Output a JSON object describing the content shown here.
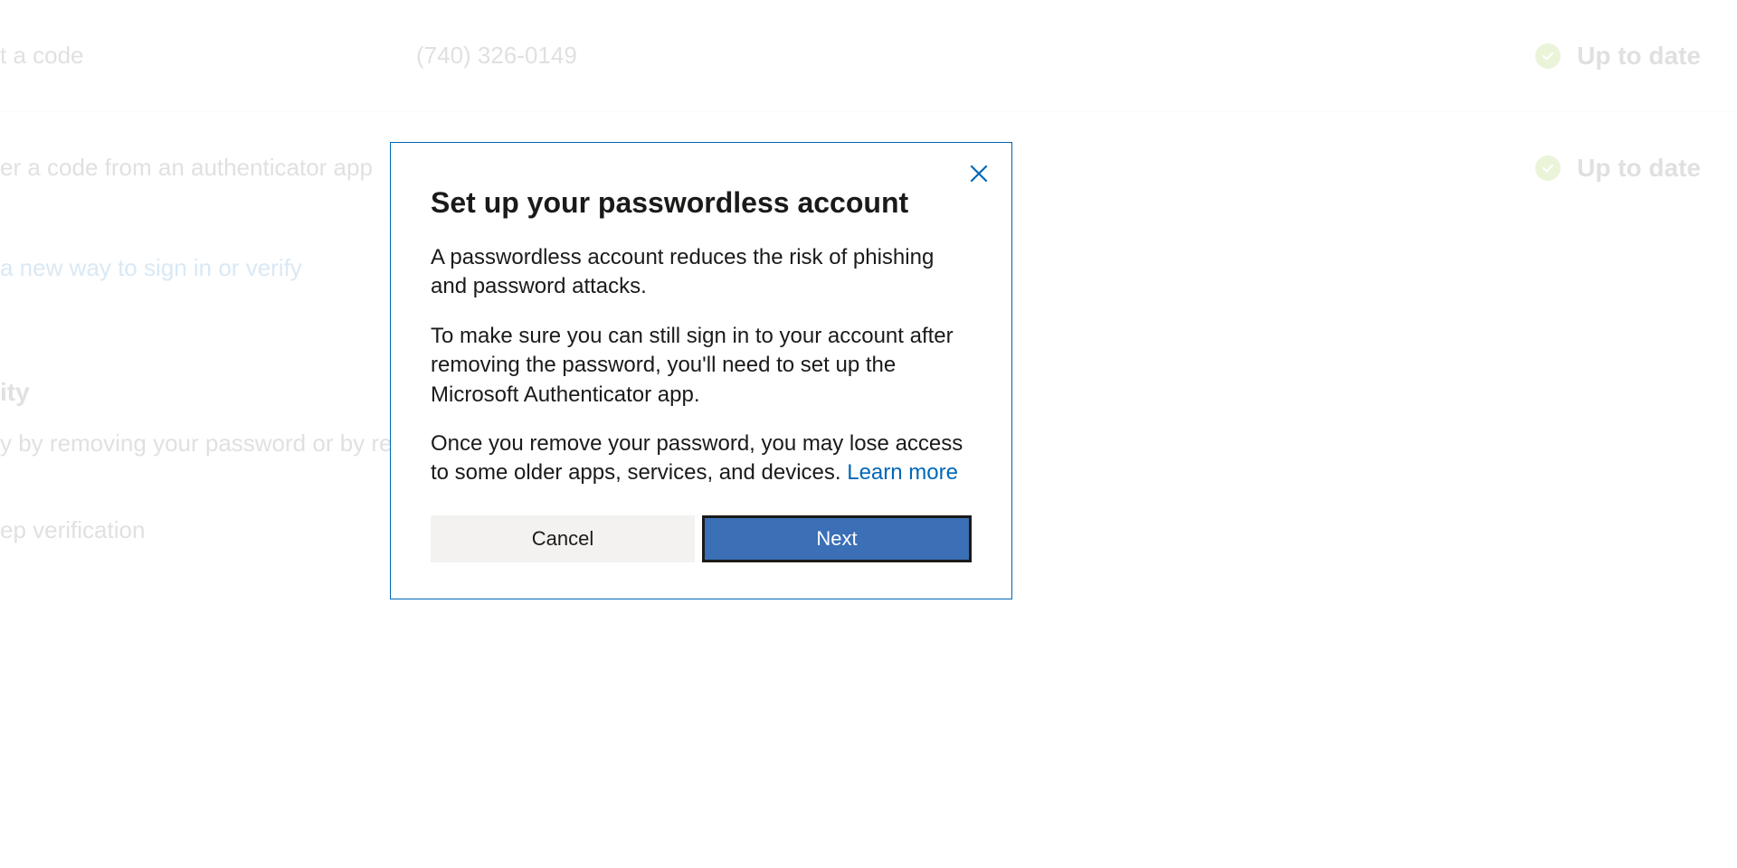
{
  "background": {
    "rows": [
      {
        "label": "t a code",
        "value": "(740) 326-0149",
        "status": "Up to date"
      },
      {
        "label": "er a code from an authenticator app",
        "value": "",
        "status": "Up to date"
      }
    ],
    "add_link": "a new way to sign in or verify",
    "section_title": "ity",
    "section_desc": "y by removing your password or by requ                                                                                                                     ore if it is right for you.",
    "subitem": "ep verification"
  },
  "modal": {
    "title": "Set up your passwordless account",
    "p1": "A passwordless account reduces the risk of phishing and password attacks.",
    "p2": "To make sure you can still sign in to your account after removing the password, you'll need to set up the Microsoft Authenticator app.",
    "p3_a": "Once you remove your password, you may lose access to some older apps, services, and devices. ",
    "learn_more": "Learn more",
    "cancel": "Cancel",
    "next": "Next"
  }
}
